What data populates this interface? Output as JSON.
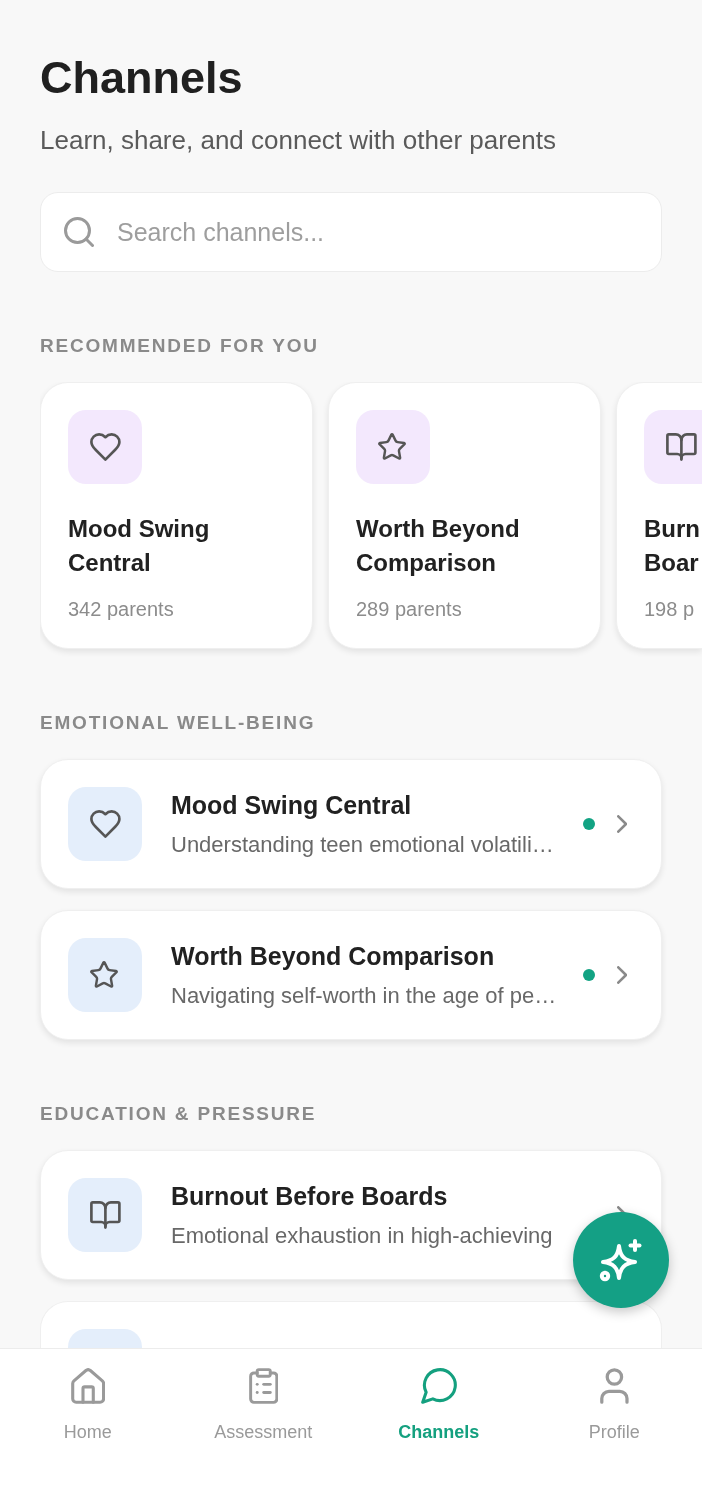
{
  "header": {
    "title": "Channels",
    "subtitle": "Learn, share, and connect with other parents"
  },
  "search": {
    "placeholder": "Search channels..."
  },
  "sections": [
    {
      "kind": "carousel",
      "title": "RECOMMENDED FOR YOU",
      "cards": [
        {
          "title": "Mood Swing Central",
          "members": "342 parents"
        },
        {
          "title": "Worth Beyond Comparison",
          "members": "289 parents"
        },
        {
          "title": "Burn Boar",
          "members": "198 p"
        }
      ]
    },
    {
      "kind": "list",
      "title": "EMOTIONAL WELL-BEING",
      "channels": [
        {
          "kind": "full",
          "title": "Mood Swing Central",
          "description": "Understanding teen emotional volatili…",
          "has_new": true
        },
        {
          "kind": "full",
          "title": "Worth Beyond Comparison",
          "description": "Navigating self-worth in the age of pe…",
          "has_new": true
        }
      ]
    },
    {
      "kind": "list",
      "title": "EDUCATION & PRESSURE",
      "channels": [
        {
          "kind": "full",
          "title": "Burnout Before Boards",
          "description": "Emotional exhaustion in high-achieving",
          "has_new": false
        },
        {
          "kind": "cut"
        }
      ]
    }
  ],
  "nav": {
    "tabs": [
      {
        "label": "Home",
        "selected": false
      },
      {
        "label": "Assessment",
        "selected": false
      },
      {
        "label": "Channels",
        "selected": true
      },
      {
        "label": "Profile",
        "selected": false
      }
    ]
  }
}
